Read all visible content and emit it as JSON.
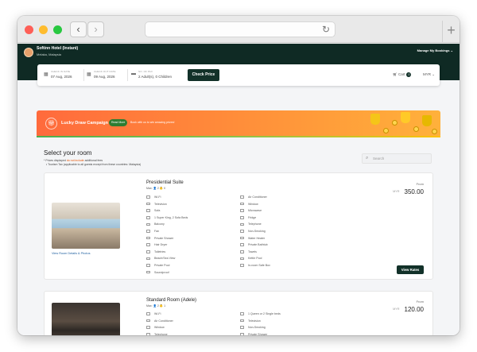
{
  "hotel": {
    "name": "Softinn Hotel (Instant)",
    "location": "Melaka, Malaysia",
    "manage_label": "Manage My Bookings ⌄"
  },
  "search": {
    "check_in_label": "CHECK IN DATE",
    "check_in": "07 Aug, 2026",
    "check_out_label": "CHECK OUT DATE",
    "check_out": "09 Aug, 2026",
    "guests_label": "NO. OF PAX",
    "guests": "2 Adult(s), 0 Children",
    "button": "Check Price",
    "cart_label": "Cart",
    "cart_count": "0",
    "currency": "MYR ⌄"
  },
  "banner": {
    "title": "Lucky Draw Campaign",
    "read_more": "Read More",
    "text": "Book with us to win amazing prizes!"
  },
  "rooms_section": {
    "title": "Select your room",
    "note_prefix": "* Prices displayed",
    "note_highlight": "do not include",
    "note_suffix": "additional fees",
    "tax_note": "• Tourism Tax (applicable to all guests except from these countries: Malaysia)",
    "search_placeholder": "Search"
  },
  "rooms": [
    {
      "name": "Presidential Suite",
      "max_label": "Max: 👤 2 👶 0",
      "link": "View Room Details & Photos",
      "from_label": "From",
      "currency": "MYR",
      "price": "350.00",
      "button": "View Rates",
      "amenities_left": [
        "Wi-Fi",
        "Television",
        "Sofa",
        "1 Super King, 2 Sofa Beds",
        "Balcony",
        "Fan",
        "Private Shower",
        "Hair Dryer",
        "Toiletries",
        "Beach/Sea View",
        "Private Pool",
        "Soundproof"
      ],
      "amenities_right": [
        "Air Conditioner",
        "Window",
        "Microwave",
        "Fridge",
        "Telephone",
        "Non-Smoking",
        "Water Heater",
        "Private Bathtub",
        "Towels",
        "Kettle Pool",
        "In-room Safe Box"
      ]
    },
    {
      "name": "Standard Room (Adele)",
      "max_label": "Max: 👤 2 👶 1",
      "from_label": "From",
      "currency": "MYR",
      "price": "120.00",
      "amenities_left": [
        "Wi-Fi",
        "Air Conditioner",
        "Window",
        "Telephone",
        "Water Heater",
        "Toiletries"
      ],
      "amenities_right": [
        "1 Queen or 2 Single beds",
        "Television",
        "Non-Smoking",
        "Private Shower",
        "Hair Dryer",
        "Towels"
      ]
    }
  ]
}
